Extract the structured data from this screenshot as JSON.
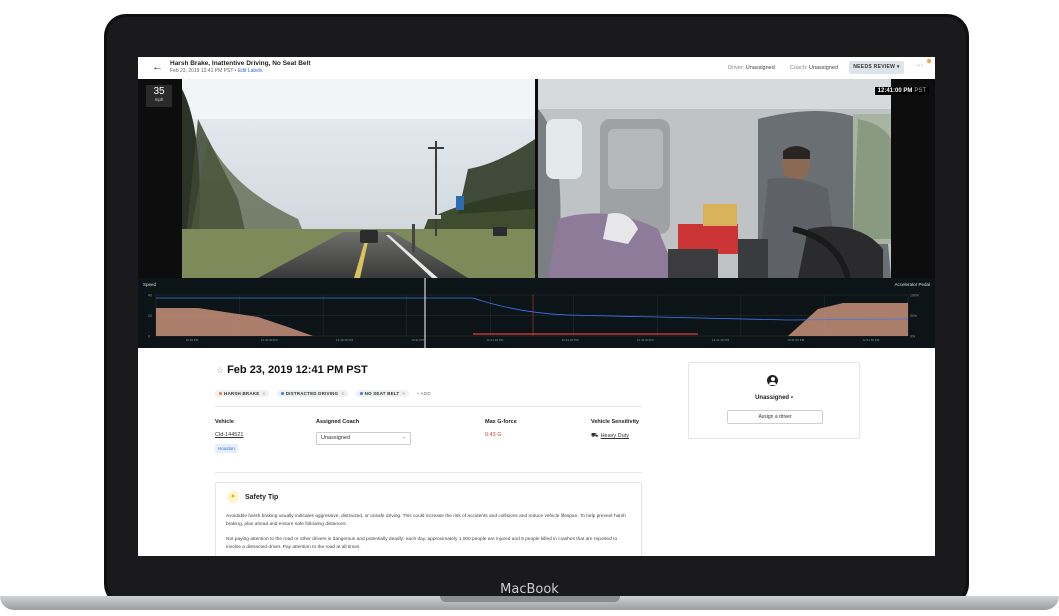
{
  "device": {
    "brand": "MacBook"
  },
  "header": {
    "title": "Harsh Brake, Inattentive Driving, No Seat Belt",
    "subtitle": "Feb 23, 2019 12:41 PM PST",
    "subtitle_sep": " • ",
    "edit_labels": "Edit Labels",
    "driver_label": "Driver:",
    "driver_value": "Unassigned",
    "coach_label": "Coach:",
    "coach_value": "Unassigned",
    "review_button": "NEEDS REVIEW ▾",
    "more": "···"
  },
  "video": {
    "speed_value": "35",
    "speed_unit": "mph",
    "timestamp": "12:41:00 PM",
    "timezone": "PST"
  },
  "graph": {
    "left_label": "Speed",
    "right_label": "Accelerator Pedal",
    "left_ticks": [
      "40",
      "20",
      "0"
    ],
    "right_ticks": [
      "100%",
      "50%",
      "0%"
    ],
    "time_ticks": [
      "12:40 PM",
      "12:40:30 PM",
      "12:40:45 PM",
      "12:41 PM",
      "12:41:10 PM",
      "12:41:20 PM",
      "12:41:30 PM",
      "12:41:40 PM",
      "12:41:50 PM",
      "12:41:55 PM"
    ],
    "colors": {
      "speed": "#3c78f0",
      "pedal": "#c8907a",
      "brake": "#e23a3a",
      "playhead": "#ffffff"
    }
  },
  "event": {
    "star": "☆",
    "date": "Feb 23, 2019 12:41 PM PST",
    "tags": [
      {
        "label": "HARSH BRAKE",
        "color": "#f07a2a"
      },
      {
        "label": "DISTRACTED DRIVING",
        "color": "#3c78f0"
      },
      {
        "label": "NO SEAT BELT",
        "color": "#3c78f0"
      }
    ],
    "tag_remove": "×",
    "add_label": "+ ADD"
  },
  "details": {
    "vehicle_label": "Vehicle",
    "vehicle_value": "Cld-144521",
    "vehicle_location": "Houston",
    "coach_label": "Assigned Coach",
    "coach_value": "Unassigned",
    "gforce_label": "Max G-force",
    "gforce_value": "0.43 G",
    "sensitivity_label": "Vehicle Sensitivity",
    "sensitivity_value": "Heavy Duty"
  },
  "safety_tip": {
    "title": "Safety Tip",
    "p1": "Avoidable harsh braking usually indicates aggressive, distracted, or unsafe driving. This could increase the risk of accidents and collisions and reduce vehicle lifespan. To help prevent harsh braking, plan ahead and ensure safe following distances.",
    "p2": "Not paying attention to the road or other drivers is dangerous and potentially deadly: each day, approximately 1,000 people are injured and 9 people killed in crashes that are reported to involve a distracted driver. Pay attention to the road at all times."
  },
  "driver_card": {
    "name": "Unassigned",
    "assign_button": "Assign a driver"
  }
}
